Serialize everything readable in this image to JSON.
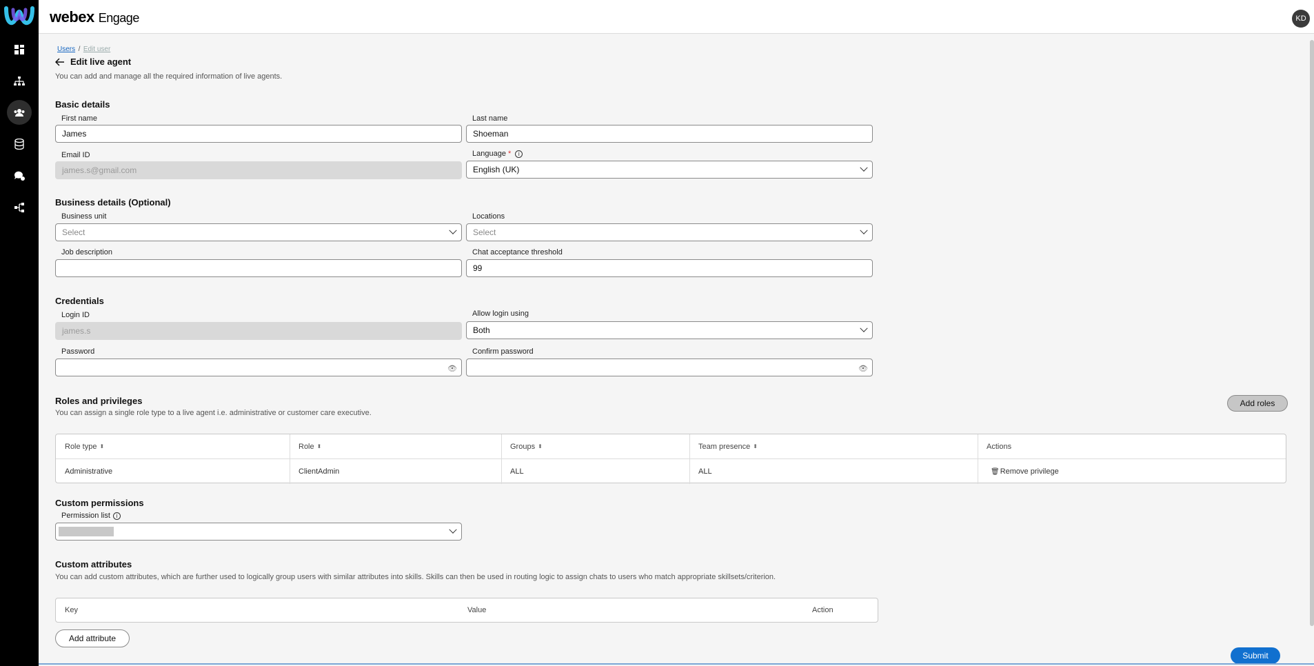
{
  "app": {
    "brand": "webex",
    "product": "Engage",
    "user_initials": "KD"
  },
  "sidebar": {
    "items": [
      {
        "icon": "dashboard-icon"
      },
      {
        "icon": "hierarchy-icon"
      },
      {
        "icon": "users-icon",
        "active": true
      },
      {
        "icon": "database-icon"
      },
      {
        "icon": "chat-icon"
      },
      {
        "icon": "integration-icon"
      }
    ]
  },
  "breadcrumb": {
    "users": "Users",
    "sep": "/",
    "current": "Edit user"
  },
  "page": {
    "title": "Edit live agent",
    "subtitle": "You can add and manage all the required information of live agents."
  },
  "basic": {
    "title": "Basic details",
    "first_name_label": "First name",
    "first_name": "James",
    "last_name_label": "Last name",
    "last_name": "Shoeman",
    "email_label": "Email ID",
    "email": "james.s@gmail.com",
    "language_label": "Language",
    "language_required": "*",
    "language": "English (UK)"
  },
  "business": {
    "title": "Business details (Optional)",
    "unit_label": "Business unit",
    "unit_placeholder": "Select",
    "locations_label": "Locations",
    "locations_placeholder": "Select",
    "job_label": "Job description",
    "job_value": "",
    "threshold_label": "Chat acceptance threshold",
    "threshold": "99"
  },
  "credentials": {
    "title": "Credentials",
    "login_label": "Login ID",
    "login": "james.s",
    "allow_label": "Allow login using",
    "allow": "Both",
    "password_label": "Password",
    "confirm_label": "Confirm password"
  },
  "roles": {
    "title": "Roles and privileges",
    "subtitle": "You can assign a single role type to a live agent i.e. administrative or customer care executive.",
    "add_button": "Add roles",
    "columns": [
      "Role type",
      "Role",
      "Groups",
      "Team presence",
      "Actions"
    ],
    "rows": [
      {
        "role_type": "Administrative",
        "role": "ClientAdmin",
        "groups": "ALL",
        "team_presence": "ALL",
        "action": "Remove privilege"
      }
    ]
  },
  "custom_permissions": {
    "title": "Custom permissions",
    "list_label": "Permission list"
  },
  "custom_attributes": {
    "title": "Custom attributes",
    "subtitle": "You can add custom attributes, which are further used to logically group users with similar attributes into skills. Skills can then be used in routing logic to assign chats to users who match appropriate skillsets/criterion.",
    "columns": [
      "Key",
      "Value",
      "Action"
    ],
    "add_button": "Add attribute"
  },
  "submit": "Submit"
}
